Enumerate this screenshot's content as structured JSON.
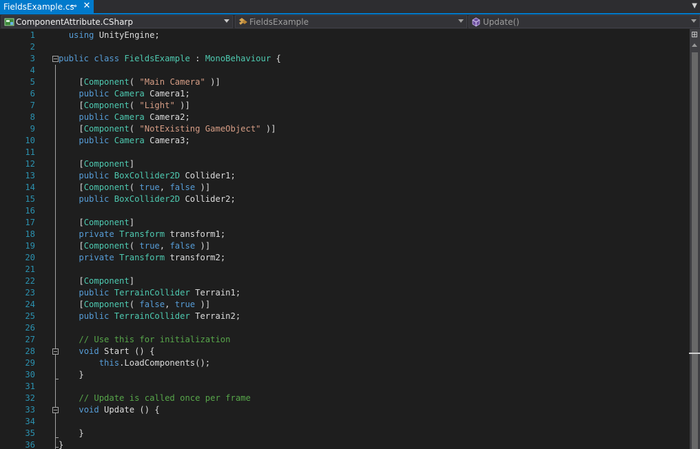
{
  "tab": {
    "title": "FieldsExample.cs",
    "pin_glyph": "⊸",
    "close_glyph": "✕",
    "overflow_glyph": "▼"
  },
  "navbar": {
    "project": {
      "label": "ComponentAttribute.CSharp",
      "icon": "csharp-project-icon"
    },
    "type": {
      "label": "FieldsExample",
      "icon": "class-icon"
    },
    "member": {
      "label": "Update()",
      "icon": "method-icon"
    }
  },
  "editor": {
    "lines": [
      {
        "n": "1",
        "tokens": [
          [
            "pl",
            "  "
          ],
          [
            "kw",
            "using"
          ],
          [
            "pl",
            " UnityEngine;"
          ]
        ]
      },
      {
        "n": "2",
        "tokens": []
      },
      {
        "n": "3",
        "fold": true,
        "tokens": [
          [
            "kw",
            "public"
          ],
          [
            "pl",
            " "
          ],
          [
            "kw",
            "class"
          ],
          [
            "pl",
            " "
          ],
          [
            "ty",
            "FieldsExample"
          ],
          [
            "pl",
            " : "
          ],
          [
            "ty",
            "MonoBehaviour"
          ],
          [
            "pl",
            " {"
          ]
        ]
      },
      {
        "n": "4",
        "tokens": []
      },
      {
        "n": "5",
        "tokens": [
          [
            "pl",
            "    ["
          ],
          [
            "ty",
            "Component"
          ],
          [
            "pl",
            "( "
          ],
          [
            "str",
            "\"Main Camera\""
          ],
          [
            "pl",
            " )]"
          ]
        ]
      },
      {
        "n": "6",
        "tokens": [
          [
            "pl",
            "    "
          ],
          [
            "kw",
            "public"
          ],
          [
            "pl",
            " "
          ],
          [
            "ty",
            "Camera"
          ],
          [
            "pl",
            " Camera1;"
          ]
        ]
      },
      {
        "n": "7",
        "tokens": [
          [
            "pl",
            "    ["
          ],
          [
            "ty",
            "Component"
          ],
          [
            "pl",
            "( "
          ],
          [
            "str",
            "\"Light\""
          ],
          [
            "pl",
            " )]"
          ]
        ]
      },
      {
        "n": "8",
        "tokens": [
          [
            "pl",
            "    "
          ],
          [
            "kw",
            "public"
          ],
          [
            "pl",
            " "
          ],
          [
            "ty",
            "Camera"
          ],
          [
            "pl",
            " Camera2;"
          ]
        ]
      },
      {
        "n": "9",
        "tokens": [
          [
            "pl",
            "    ["
          ],
          [
            "ty",
            "Component"
          ],
          [
            "pl",
            "( "
          ],
          [
            "str",
            "\"NotExisting GameObject\""
          ],
          [
            "pl",
            " )]"
          ]
        ]
      },
      {
        "n": "10",
        "tokens": [
          [
            "pl",
            "    "
          ],
          [
            "kw",
            "public"
          ],
          [
            "pl",
            " "
          ],
          [
            "ty",
            "Camera"
          ],
          [
            "pl",
            " Camera3;"
          ]
        ]
      },
      {
        "n": "11",
        "tokens": []
      },
      {
        "n": "12",
        "tokens": [
          [
            "pl",
            "    ["
          ],
          [
            "ty",
            "Component"
          ],
          [
            "pl",
            "]"
          ]
        ]
      },
      {
        "n": "13",
        "tokens": [
          [
            "pl",
            "    "
          ],
          [
            "kw",
            "public"
          ],
          [
            "pl",
            " "
          ],
          [
            "ty",
            "BoxCollider2D"
          ],
          [
            "pl",
            " Collider1;"
          ]
        ]
      },
      {
        "n": "14",
        "tokens": [
          [
            "pl",
            "    ["
          ],
          [
            "ty",
            "Component"
          ],
          [
            "pl",
            "( "
          ],
          [
            "kw",
            "true"
          ],
          [
            "pl",
            ", "
          ],
          [
            "kw",
            "false"
          ],
          [
            "pl",
            " )]"
          ]
        ]
      },
      {
        "n": "15",
        "tokens": [
          [
            "pl",
            "    "
          ],
          [
            "kw",
            "public"
          ],
          [
            "pl",
            " "
          ],
          [
            "ty",
            "BoxCollider2D"
          ],
          [
            "pl",
            " Collider2;"
          ]
        ]
      },
      {
        "n": "16",
        "tokens": []
      },
      {
        "n": "17",
        "tokens": [
          [
            "pl",
            "    ["
          ],
          [
            "ty",
            "Component"
          ],
          [
            "pl",
            "]"
          ]
        ]
      },
      {
        "n": "18",
        "tokens": [
          [
            "pl",
            "    "
          ],
          [
            "kw",
            "private"
          ],
          [
            "pl",
            " "
          ],
          [
            "ty",
            "Transform"
          ],
          [
            "pl",
            " transform1;"
          ]
        ]
      },
      {
        "n": "19",
        "tokens": [
          [
            "pl",
            "    ["
          ],
          [
            "ty",
            "Component"
          ],
          [
            "pl",
            "( "
          ],
          [
            "kw",
            "true"
          ],
          [
            "pl",
            ", "
          ],
          [
            "kw",
            "false"
          ],
          [
            "pl",
            " )]"
          ]
        ]
      },
      {
        "n": "20",
        "tokens": [
          [
            "pl",
            "    "
          ],
          [
            "kw",
            "private"
          ],
          [
            "pl",
            " "
          ],
          [
            "ty",
            "Transform"
          ],
          [
            "pl",
            " transform2;"
          ]
        ]
      },
      {
        "n": "21",
        "tokens": []
      },
      {
        "n": "22",
        "tokens": [
          [
            "pl",
            "    ["
          ],
          [
            "ty",
            "Component"
          ],
          [
            "pl",
            "]"
          ]
        ]
      },
      {
        "n": "23",
        "tokens": [
          [
            "pl",
            "    "
          ],
          [
            "kw",
            "public"
          ],
          [
            "pl",
            " "
          ],
          [
            "ty",
            "TerrainCollider"
          ],
          [
            "pl",
            " Terrain1;"
          ]
        ]
      },
      {
        "n": "24",
        "tokens": [
          [
            "pl",
            "    ["
          ],
          [
            "ty",
            "Component"
          ],
          [
            "pl",
            "( "
          ],
          [
            "kw",
            "false"
          ],
          [
            "pl",
            ", "
          ],
          [
            "kw",
            "true"
          ],
          [
            "pl",
            " )]"
          ]
        ]
      },
      {
        "n": "25",
        "tokens": [
          [
            "pl",
            "    "
          ],
          [
            "kw",
            "public"
          ],
          [
            "pl",
            " "
          ],
          [
            "ty",
            "TerrainCollider"
          ],
          [
            "pl",
            " Terrain2;"
          ]
        ]
      },
      {
        "n": "26",
        "tokens": []
      },
      {
        "n": "27",
        "tokens": [
          [
            "pl",
            "    "
          ],
          [
            "cm",
            "// Use this for initialization"
          ]
        ]
      },
      {
        "n": "28",
        "fold": true,
        "tokens": [
          [
            "pl",
            "    "
          ],
          [
            "kw",
            "void"
          ],
          [
            "pl",
            " Start () {"
          ]
        ]
      },
      {
        "n": "29",
        "tokens": [
          [
            "pl",
            "        "
          ],
          [
            "kw",
            "this"
          ],
          [
            "pl",
            ".LoadComponents();"
          ]
        ]
      },
      {
        "n": "30",
        "tokens": [
          [
            "pl",
            "    }"
          ]
        ]
      },
      {
        "n": "31",
        "tokens": []
      },
      {
        "n": "32",
        "tokens": [
          [
            "pl",
            "    "
          ],
          [
            "cm",
            "// Update is called once per frame"
          ]
        ]
      },
      {
        "n": "33",
        "fold": true,
        "tokens": [
          [
            "pl",
            "    "
          ],
          [
            "kw",
            "void"
          ],
          [
            "pl",
            " Update () {"
          ]
        ]
      },
      {
        "n": "34",
        "tokens": []
      },
      {
        "n": "35",
        "tokens": [
          [
            "pl",
            "    }"
          ]
        ]
      },
      {
        "n": "36",
        "tokens": [
          [
            "pl",
            "}"
          ]
        ]
      }
    ]
  },
  "scrollbar": {
    "split_glyph": "⊞"
  }
}
